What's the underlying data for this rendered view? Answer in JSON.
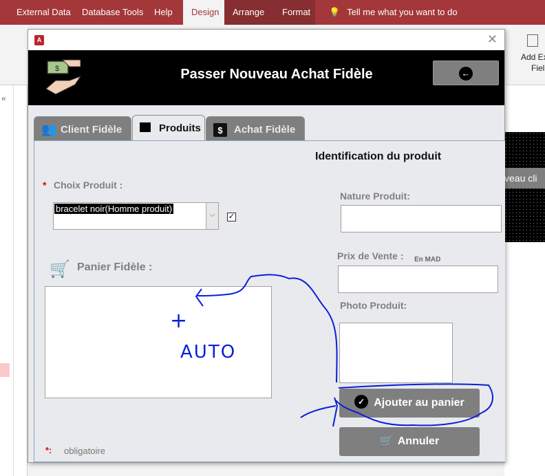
{
  "ribbon": {
    "tabs": [
      {
        "label": "External Data"
      },
      {
        "label": "Database Tools"
      },
      {
        "label": "Help"
      },
      {
        "label": "Design"
      },
      {
        "label": "Arrange"
      },
      {
        "label": "Format"
      }
    ],
    "active_tab": "Design",
    "tell_me": "Tell me what you want to do",
    "add_existing_fields_line1": "Add Ex",
    "add_existing_fields_line2": "Fiel"
  },
  "background_form": {
    "band_text": "veau cli"
  },
  "dialog": {
    "title": "Passer Nouveau Achat Fidèle",
    "tabs": [
      {
        "label": "Client Fidèle",
        "icon": "users-icon"
      },
      {
        "label": "Produits",
        "icon": "box-icon"
      },
      {
        "label": "Achat Fidèle",
        "icon": "dollar-window-icon"
      }
    ],
    "selected_tab": "Produits",
    "section_title": "Identification du produit",
    "choix_produit": {
      "label": "Choix Produit :",
      "value": "bracelet noir(Homme produit)",
      "checked": true
    },
    "nature_produit": {
      "label": "Nature Produit:",
      "value": ""
    },
    "prix_vente": {
      "label": "Prix de Vente :",
      "unit": "En MAD",
      "value": ""
    },
    "photo_produit": {
      "label": "Photo Produit:"
    },
    "panier": {
      "label": "Panier Fidèle :"
    },
    "buttons": {
      "ajouter": "Ajouter au panier",
      "annuler": "Annuler"
    },
    "legend": {
      "marker": "*:",
      "text": "obligatoire"
    },
    "required_marker": "*"
  },
  "annotation": {
    "plus": "+",
    "text": "AUTO",
    "color": "#0a1edc"
  },
  "colors": {
    "ribbon": "#a4373a",
    "button": "#7f7f7f",
    "required": "#e00000"
  }
}
